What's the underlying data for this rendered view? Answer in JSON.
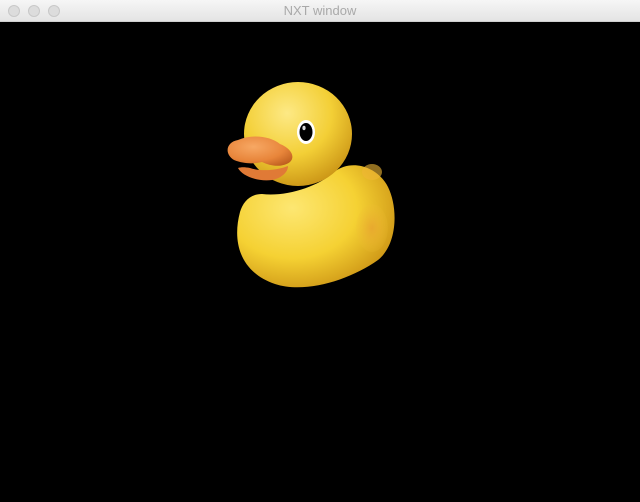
{
  "window": {
    "title": "NXT window"
  },
  "viewport": {
    "background": "#000000",
    "object": "rubber-duck-3d-model",
    "duck_colors": {
      "body": "#f5d133",
      "body_shade": "#d9a21a",
      "beak": "#ea8a3c",
      "eye": "#000000"
    }
  }
}
